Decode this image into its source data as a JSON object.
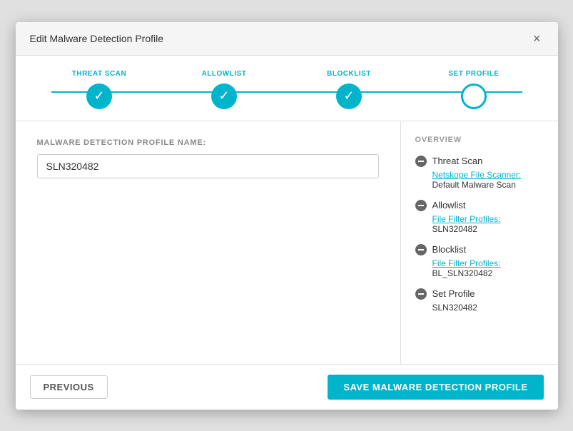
{
  "dialog": {
    "title": "Edit Malware Detection Profile",
    "close_label": "×"
  },
  "stepper": {
    "steps": [
      {
        "label": "THREAT SCAN",
        "state": "complete"
      },
      {
        "label": "ALLOWLIST",
        "state": "complete"
      },
      {
        "label": "BLOCKLIST",
        "state": "complete"
      },
      {
        "label": "SET PROFILE",
        "state": "active"
      }
    ]
  },
  "left_panel": {
    "field_label": "MALWARE DETECTION PROFILE NAME:",
    "field_value": "SLN320482"
  },
  "right_panel": {
    "overview_title": "OVERVIEW",
    "items": [
      {
        "name": "Threat Scan",
        "sub_label": "Netskope File Scanner:",
        "sub_value": "Default Malware Scan"
      },
      {
        "name": "Allowlist",
        "sub_label": "File Filter Profiles:",
        "sub_value": "SLN320482"
      },
      {
        "name": "Blocklist",
        "sub_label": "File Filter Profiles:",
        "sub_value": "BL_SLN320482"
      },
      {
        "name": "Set Profile",
        "sub_label": "",
        "sub_value": "SLN320482"
      }
    ]
  },
  "footer": {
    "previous_label": "PREVIOUS",
    "save_label": "SAVE MALWARE DETECTION PROFILE"
  },
  "colors": {
    "accent": "#00b4cc"
  }
}
